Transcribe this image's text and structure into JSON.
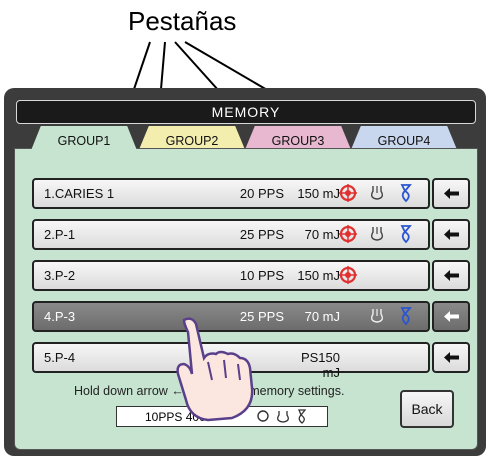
{
  "annotation": {
    "label": "Pestañas"
  },
  "screen": {
    "title": "MEMORY",
    "tabs": [
      {
        "label": "GROUP1",
        "color": "#c6e4d0",
        "active": true
      },
      {
        "label": "GROUP2",
        "color": "#f3eeae",
        "active": false
      },
      {
        "label": "GROUP3",
        "color": "#e7b8cf",
        "active": false
      },
      {
        "label": "GROUP4",
        "color": "#c8d6ee",
        "active": false
      }
    ],
    "memories": [
      {
        "name": "1.CARIES 1",
        "pps": "20 PPS",
        "energy": "150 mJ",
        "icons": [
          "target-icon",
          "bell-icon",
          "blade-icon"
        ],
        "selected": false
      },
      {
        "name": "2.P-1",
        "pps": "25 PPS",
        "energy": "70 mJ",
        "icons": [
          "target-icon",
          "bell-icon",
          "blade-icon"
        ],
        "selected": false
      },
      {
        "name": "3.P-2",
        "pps": "10 PPS",
        "energy": "150 mJ",
        "icons": [
          "target-icon"
        ],
        "selected": false
      },
      {
        "name": "4.P-3",
        "pps": "25 PPS",
        "energy": "70 mJ",
        "icons": [
          "bell-icon",
          "blade-icon"
        ],
        "selected": true
      },
      {
        "name": "5.P-4",
        "pps": "",
        "energy": "PS150 mJ",
        "icons": [],
        "selected": false
      }
    ],
    "hint_left": "Hold down arrow",
    "hint_right": "memory settings.",
    "summary": "10PPS 400",
    "back_label": "Back",
    "colors": {
      "target": "#e03030",
      "blade": "#2a55d0"
    }
  }
}
